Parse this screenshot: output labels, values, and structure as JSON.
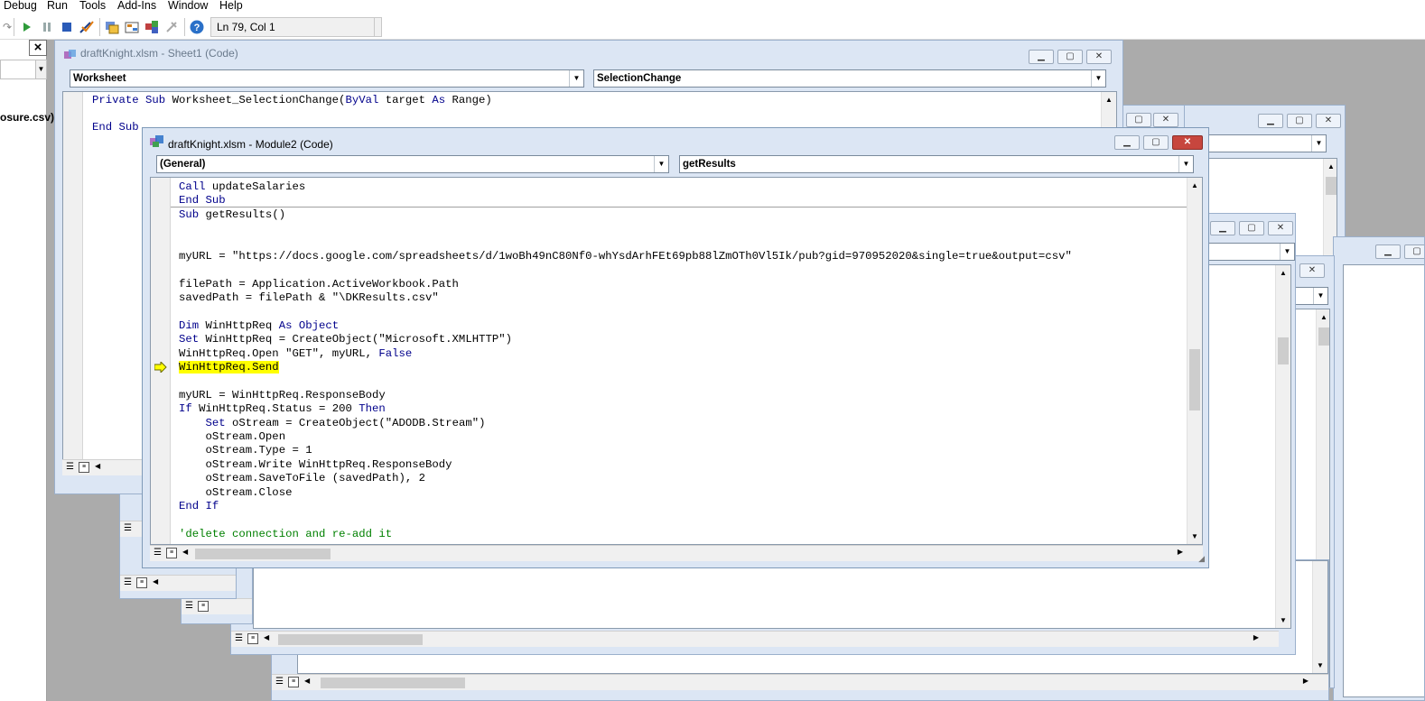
{
  "menu": [
    "Debug",
    "Run",
    "Tools",
    "Add-Ins",
    "Window",
    "Help"
  ],
  "toolbar": {
    "cursor_position": "Ln 79, Col 1"
  },
  "left_pane": {
    "file_label": "osure.csv)"
  },
  "sheet_window": {
    "title": "draftKnight.xlsm - Sheet1 (Code)",
    "object_combo": "Worksheet",
    "proc_combo": "SelectionChange",
    "code": [
      [
        {
          "t": "Private Sub",
          "c": "kw"
        },
        {
          "t": " Worksheet_SelectionChange(",
          "c": ""
        },
        {
          "t": "ByVal",
          "c": "kw"
        },
        {
          "t": " target ",
          "c": ""
        },
        {
          "t": "As",
          "c": "kw"
        },
        {
          "t": " Range)",
          "c": ""
        }
      ],
      [],
      [
        {
          "t": "End Sub",
          "c": "kw"
        }
      ]
    ]
  },
  "module_window": {
    "title": "draftKnight.xlsm - Module2 (Code)",
    "object_combo": "(General)",
    "proc_combo": "getResults",
    "execution_line_index": 12,
    "code": [
      [
        {
          "t": "Call",
          "c": "kw"
        },
        {
          "t": " updateSalaries",
          "c": ""
        }
      ],
      [
        {
          "t": "End Sub",
          "c": "kw"
        }
      ],
      [
        {
          "t": "Sub",
          "c": "kw"
        },
        {
          "t": " getResults()",
          "c": ""
        }
      ],
      [],
      [],
      [
        {
          "t": "myURL = \"https://docs.google.com/spreadsheets/d/1woBh49nC80Nf0-whYsdArhFEt69pb88lZmOTh0Vl5Ik/pub?gid=970952020&single=true&output=csv\"",
          "c": ""
        }
      ],
      [],
      [
        {
          "t": "filePath = Application.ActiveWorkbook.Path",
          "c": ""
        }
      ],
      [
        {
          "t": "savedPath = filePath & \"\\DKResults.csv\"",
          "c": ""
        }
      ],
      [],
      [
        {
          "t": "Dim",
          "c": "kw"
        },
        {
          "t": " WinHttpReq ",
          "c": ""
        },
        {
          "t": "As Object",
          "c": "kw"
        }
      ],
      [
        {
          "t": "Set",
          "c": "kw"
        },
        {
          "t": " WinHttpReq = CreateObject(\"Microsoft.XMLHTTP\")",
          "c": ""
        }
      ],
      [
        {
          "t": "WinHttpReq.Send",
          "c": "hl"
        }
      ],
      [],
      [
        {
          "t": "myURL = WinHttpReq.ResponseBody",
          "c": ""
        }
      ],
      [
        {
          "t": "If",
          "c": "kw"
        },
        {
          "t": " WinHttpReq.Status = 200 ",
          "c": ""
        },
        {
          "t": "Then",
          "c": "kw"
        }
      ],
      [
        {
          "t": "    ",
          "c": ""
        },
        {
          "t": "Set",
          "c": "kw"
        },
        {
          "t": " oStream = CreateObject(\"ADODB.Stream\")",
          "c": ""
        }
      ],
      [
        {
          "t": "    oStream.Open",
          "c": ""
        }
      ],
      [
        {
          "t": "    oStream.Type = 1",
          "c": ""
        }
      ],
      [
        {
          "t": "    oStream.Write WinHttpReq.ResponseBody",
          "c": ""
        }
      ],
      [
        {
          "t": "    oStream.SaveToFile (savedPath), 2",
          "c": ""
        }
      ],
      [
        {
          "t": "    oStream.Close",
          "c": ""
        }
      ],
      [
        {
          "t": "End If",
          "c": "kw"
        }
      ],
      [],
      [
        {
          "t": "'delete connection and re-add it",
          "c": "cmt"
        }
      ]
    ],
    "open_line": [
      {
        "t": "WinHttpReq.Open \"GET\", myURL, ",
        "c": ""
      },
      {
        "t": "False",
        "c": "kw"
      }
    ]
  }
}
